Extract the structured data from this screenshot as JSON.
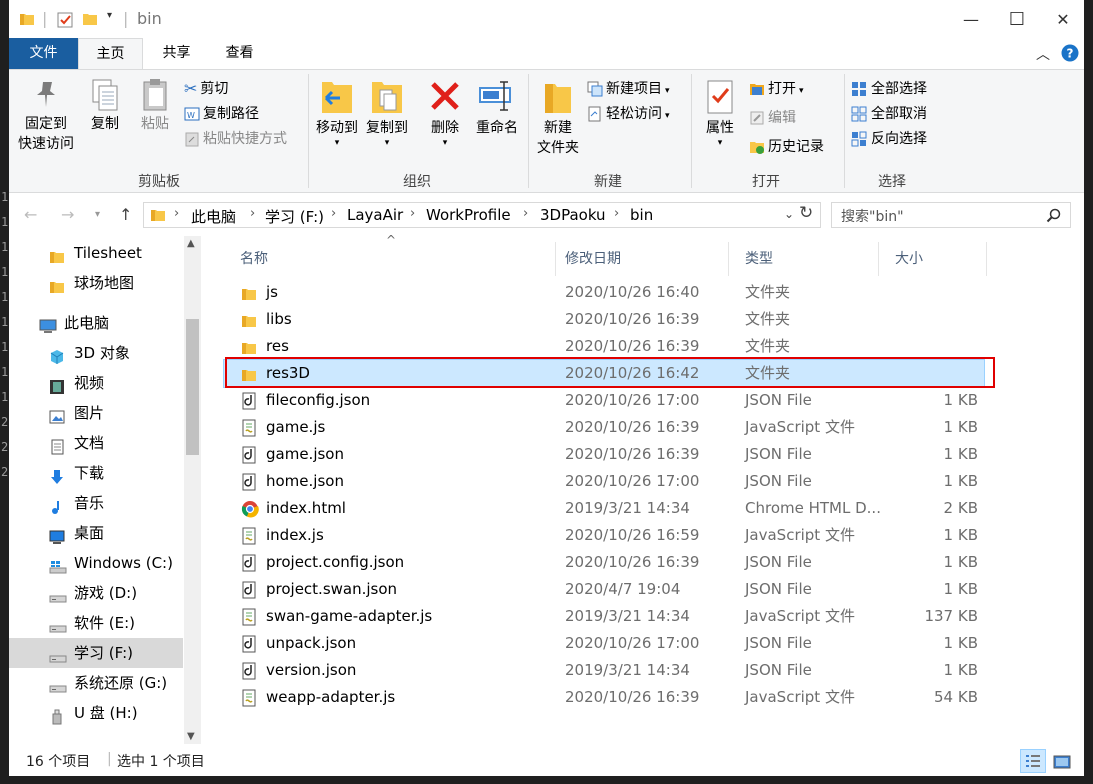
{
  "window": {
    "title": "bin",
    "minimize": "—",
    "maximize": "☐",
    "close": "✕"
  },
  "ribbon_tabs": [
    "文件",
    "主页",
    "共享",
    "查看"
  ],
  "ribbon": {
    "clipboard": {
      "label": "剪贴板",
      "pin": [
        "固定到",
        "快速访问"
      ],
      "copy": "复制",
      "paste": "粘贴",
      "cut": "剪切",
      "copy_path": "复制路径",
      "paste_shortcut": "粘贴快捷方式"
    },
    "organize": {
      "label": "组织",
      "move_to": "移动到",
      "copy_to": "复制到",
      "delete": "删除",
      "rename": "重命名"
    },
    "new": {
      "label": "新建",
      "new_folder": [
        "新建",
        "文件夹"
      ],
      "new_item": "新建项目",
      "easy_access": "轻松访问"
    },
    "open": {
      "label": "打开",
      "properties": "属性",
      "open": "打开",
      "edit": "编辑",
      "history": "历史记录"
    },
    "select": {
      "label": "选择",
      "select_all": "全部选择",
      "select_none": "全部取消",
      "invert": "反向选择"
    }
  },
  "address": {
    "crumbs": [
      "此电脑",
      "学习 (F:)",
      "LayaAir",
      "WorkProfile",
      "3DPaoku",
      "bin"
    ],
    "search_placeholder": "搜索\"bin\""
  },
  "nav_items": [
    {
      "label": "Tilesheet",
      "icon": "folder-icon"
    },
    {
      "label": "球场地图",
      "icon": "folder-icon"
    },
    {
      "label": "此电脑",
      "icon": "computer-icon"
    },
    {
      "label": "3D 对象",
      "icon": "3d-objects-icon"
    },
    {
      "label": "视频",
      "icon": "video-icon"
    },
    {
      "label": "图片",
      "icon": "pictures-icon"
    },
    {
      "label": "文档",
      "icon": "documents-icon"
    },
    {
      "label": "下载",
      "icon": "download-icon"
    },
    {
      "label": "音乐",
      "icon": "music-icon"
    },
    {
      "label": "桌面",
      "icon": "desktop-icon"
    },
    {
      "label": "Windows (C:)",
      "icon": "windows-drive-icon"
    },
    {
      "label": "游戏 (D:)",
      "icon": "drive-icon"
    },
    {
      "label": "软件 (E:)",
      "icon": "drive-icon"
    },
    {
      "label": "学习 (F:)",
      "icon": "drive-icon"
    },
    {
      "label": "系统还原 (G:)",
      "icon": "drive-icon"
    },
    {
      "label": "U 盘 (H:)",
      "icon": "usb-drive-icon"
    }
  ],
  "columns": [
    "名称",
    "修改日期",
    "类型",
    "大小"
  ],
  "files": [
    {
      "name": "js",
      "date": "2020/10/26 16:40",
      "type": "文件夹",
      "size": "",
      "icon": "folder-icon"
    },
    {
      "name": "libs",
      "date": "2020/10/26 16:39",
      "type": "文件夹",
      "size": "",
      "icon": "folder-icon"
    },
    {
      "name": "res",
      "date": "2020/10/26 16:39",
      "type": "文件夹",
      "size": "",
      "icon": "folder-icon"
    },
    {
      "name": "res3D",
      "date": "2020/10/26 16:42",
      "type": "文件夹",
      "size": "",
      "icon": "folder-icon",
      "selected": true
    },
    {
      "name": "fileconfig.json",
      "date": "2020/10/26 17:00",
      "type": "JSON File",
      "size": "1 KB",
      "icon": "json-file-icon"
    },
    {
      "name": "game.js",
      "date": "2020/10/26 16:39",
      "type": "JavaScript 文件",
      "size": "1 KB",
      "icon": "js-file-icon"
    },
    {
      "name": "game.json",
      "date": "2020/10/26 16:39",
      "type": "JSON File",
      "size": "1 KB",
      "icon": "json-file-icon"
    },
    {
      "name": "home.json",
      "date": "2020/10/26 17:00",
      "type": "JSON File",
      "size": "1 KB",
      "icon": "json-file-icon"
    },
    {
      "name": "index.html",
      "date": "2019/3/21 14:34",
      "type": "Chrome HTML D...",
      "size": "2 KB",
      "icon": "chrome-html-icon"
    },
    {
      "name": "index.js",
      "date": "2020/10/26 16:59",
      "type": "JavaScript 文件",
      "size": "1 KB",
      "icon": "js-file-icon"
    },
    {
      "name": "project.config.json",
      "date": "2020/10/26 16:39",
      "type": "JSON File",
      "size": "1 KB",
      "icon": "json-file-icon"
    },
    {
      "name": "project.swan.json",
      "date": "2020/4/7 19:04",
      "type": "JSON File",
      "size": "1 KB",
      "icon": "json-file-icon"
    },
    {
      "name": "swan-game-adapter.js",
      "date": "2019/3/21 14:34",
      "type": "JavaScript 文件",
      "size": "137 KB",
      "icon": "js-file-icon"
    },
    {
      "name": "unpack.json",
      "date": "2020/10/26 17:00",
      "type": "JSON File",
      "size": "1 KB",
      "icon": "json-file-icon"
    },
    {
      "name": "version.json",
      "date": "2019/3/21 14:34",
      "type": "JSON File",
      "size": "1 KB",
      "icon": "json-file-icon"
    },
    {
      "name": "weapp-adapter.js",
      "date": "2020/10/26 16:39",
      "type": "JavaScript 文件",
      "size": "54 KB",
      "icon": "js-file-icon"
    }
  ],
  "status": {
    "item_count": "16 个项目",
    "selected": "选中 1 个项目"
  },
  "sliver_digits": [
    "1",
    "1",
    "1",
    "1",
    "1",
    "1",
    "1",
    "1",
    "1",
    "2",
    "2",
    "2"
  ],
  "colors": {
    "accent": "#1a5ea0",
    "selection": "#cce8ff",
    "highlight_box": "#e00000",
    "folder": "#f8c748"
  }
}
